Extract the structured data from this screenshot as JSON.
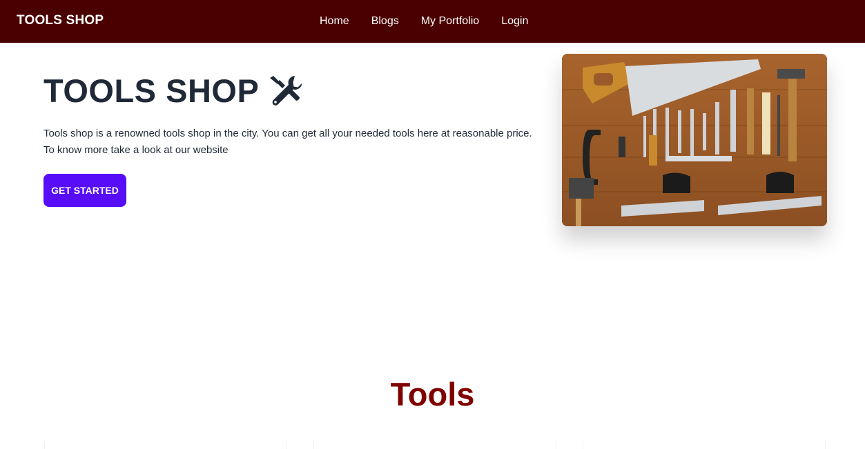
{
  "navbar": {
    "brand": "TOOLS SHOP",
    "links": [
      "Home",
      "Blogs",
      "My Portfolio",
      "Login"
    ],
    "background": "#4a0000"
  },
  "hero": {
    "title": "TOOLS SHOP",
    "icon": "screwdriver-wrench-icon",
    "description": "Tools shop is a renowned tools shop in the city. You can get all your needed tools here at reasonable price. To know more take a look at our website",
    "button_label": "GET STARTED",
    "button_color": "#570df8",
    "image": "tools-flatlay-image"
  },
  "tools_section": {
    "title": "Tools",
    "title_color": "#800000"
  }
}
